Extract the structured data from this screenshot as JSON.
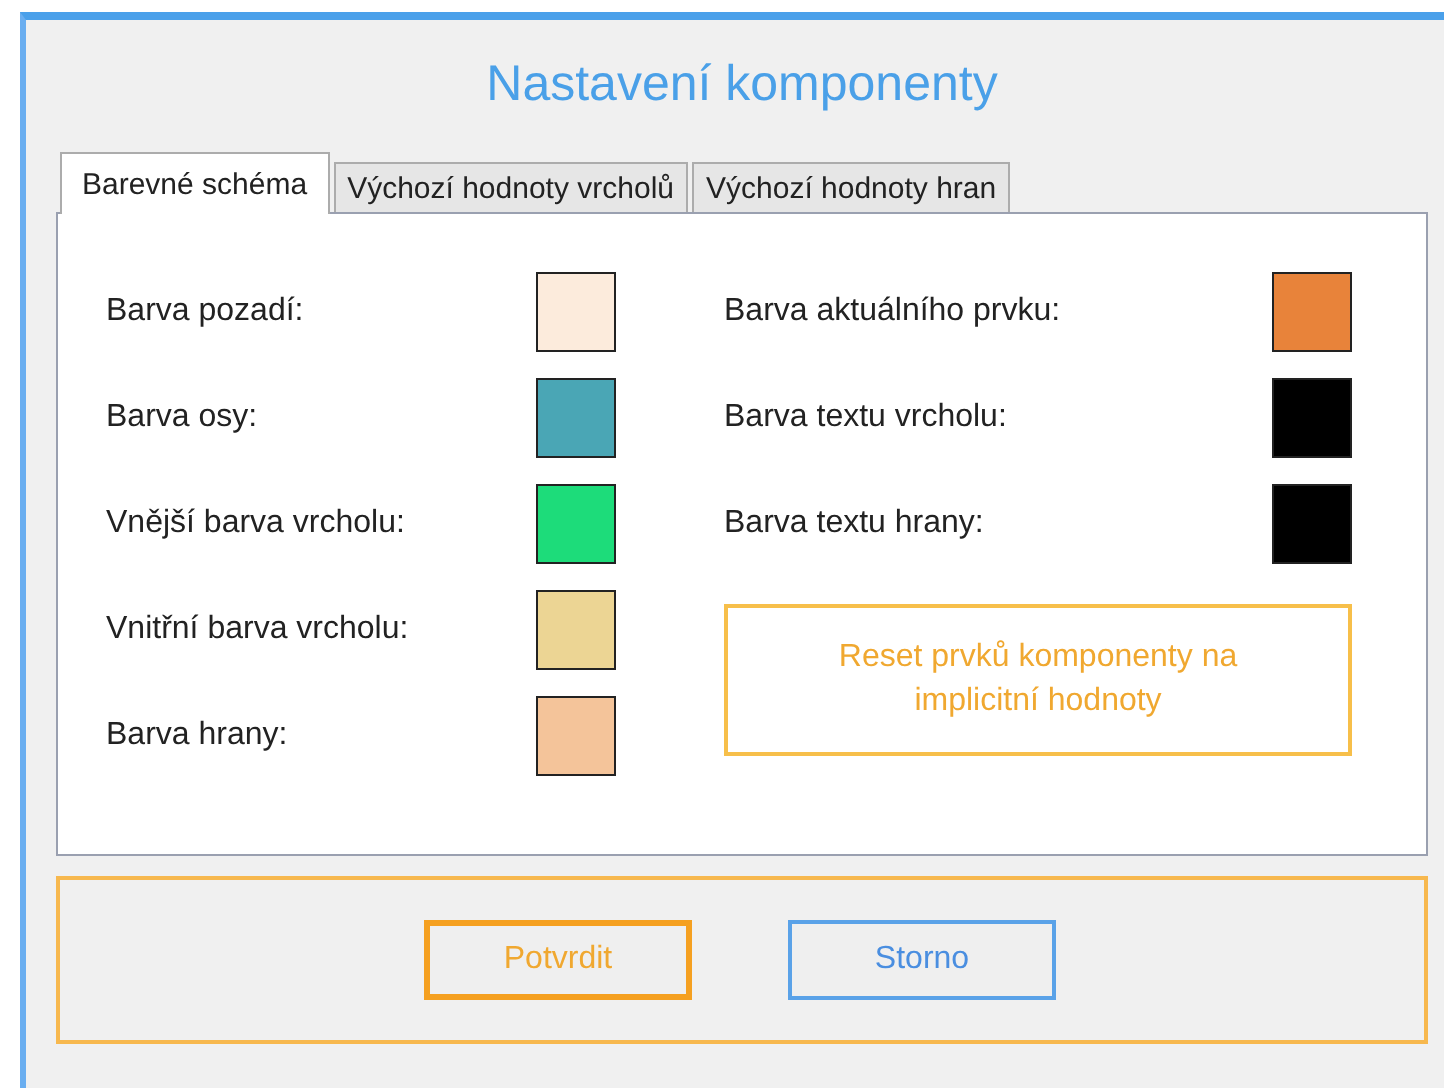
{
  "title": "Nastavení komponenty",
  "tabs": [
    {
      "label": "Barevné schéma",
      "selected": true
    },
    {
      "label": "Výchozí hodnoty vrcholů",
      "selected": false
    },
    {
      "label": "Výchozí hodnoty hran",
      "selected": false
    }
  ],
  "left_colors": [
    {
      "label": "Barva pozadí:",
      "color": "#fcebdc"
    },
    {
      "label": "Barva osy:",
      "color": "#4aa6b5"
    },
    {
      "label": "Vnější barva vrcholu:",
      "color": "#1ddc7a"
    },
    {
      "label": "Vnitřní barva vrcholu:",
      "color": "#ecd594"
    },
    {
      "label": "Barva hrany:",
      "color": "#f4c49a"
    }
  ],
  "right_colors": [
    {
      "label": "Barva aktuálního prvku:",
      "color": "#e8833a"
    },
    {
      "label": "Barva textu vrcholu:",
      "color": "#000000"
    },
    {
      "label": "Barva textu hrany:",
      "color": "#000000"
    }
  ],
  "reset_button": "Reset prvků komponenty na implicitní hodnoty",
  "buttons": [
    {
      "label": "Potvrdit",
      "kind": "primary"
    },
    {
      "label": "Storno",
      "kind": "secondary"
    }
  ]
}
